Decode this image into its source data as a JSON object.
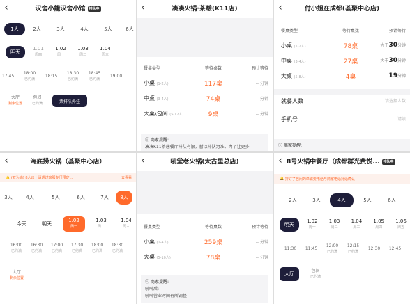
{
  "p1": {
    "title": "汉舍小籠汉舍小馆",
    "badge": "排队中",
    "party": [
      "1人",
      "2人",
      "3人",
      "4人",
      "5人",
      "6人"
    ],
    "days": [
      {
        "d": "明天",
        "s": ""
      },
      {
        "d": "1.01",
        "s": "周四"
      },
      {
        "d": "1.02",
        "s": "周一"
      },
      {
        "d": "1.03",
        "s": "周二"
      },
      {
        "d": "1.04",
        "s": "周三"
      }
    ],
    "times": [
      "17:45",
      "18:00",
      "18:15",
      "18:30",
      "18:45",
      "19:00"
    ],
    "time_sub": [
      "",
      "已约满",
      "",
      "已约满",
      "已约满",
      ""
    ],
    "areas": [
      {
        "n": "大厅",
        "s": "剩余位置"
      },
      {
        "n": "包间",
        "s": "已约满"
      }
    ],
    "btn": "票排队外挂"
  },
  "p2": {
    "title": "凑凑火锅·茶憩(K11店)",
    "head": [
      "餐桌类型",
      "等待桌数",
      "预计等待"
    ],
    "rows": [
      {
        "t": "小桌",
        "r": "(1-2人)",
        "n": "117桌",
        "w": "-- 分钟"
      },
      {
        "t": "中桌",
        "r": "(3-4人)",
        "n": "74桌",
        "w": "-- 分钟"
      },
      {
        "t": "大桌\\包间",
        "r": "(5-12人)",
        "n": "9桌",
        "w": "-- 分钟"
      }
    ],
    "notice_title": "商家提醒:",
    "notice_text": "凑凑K11茶憩餐厅排队有限，暂以排队为准，为了让更多"
  },
  "p3": {
    "title": "付小姐在成都(荟聚中心店)",
    "head": [
      "餐桌类型",
      "等待桌数",
      "预计等待"
    ],
    "rows": [
      {
        "t": "小桌",
        "r": "(1-2人)",
        "n": "78桌",
        "p": "大于",
        "w": "30",
        "u": "分钟"
      },
      {
        "t": "中桌",
        "r": "(3-4人)",
        "n": "27桌",
        "p": "大于",
        "w": "30",
        "u": "分钟"
      },
      {
        "t": "大桌",
        "r": "(5-8人)",
        "n": "4桌",
        "p": "",
        "w": "19",
        "u": "分钟"
      }
    ],
    "people_label": "就餐人数",
    "people_ph": "请选择人数",
    "phone_label": "手机号",
    "phone_ph": "请填",
    "notice_title": "商家提醒:"
  },
  "p4": {
    "title": "海底捞火锅（荟聚中心店）",
    "alert": "(双为满) 8人以上请通过客服专门预定...",
    "alert_r": "去看看",
    "party": [
      "3人",
      "4人",
      "5人",
      "6人",
      "7人",
      "8人"
    ],
    "days": [
      {
        "d": "今天",
        "s": ""
      },
      {
        "d": "明天",
        "s": ""
      },
      {
        "d": "1.02",
        "s": "周一"
      },
      {
        "d": "1.03",
        "s": "周二"
      },
      {
        "d": "1.04",
        "s": "周三"
      }
    ],
    "times": [
      "16:00",
      "16:30",
      "17:00",
      "17:30",
      "18:00",
      "18:30"
    ],
    "time_sub": [
      "已约满",
      "已约满",
      "已约满",
      "已约满",
      "已约满",
      "已约满"
    ],
    "area": {
      "n": "大厅",
      "s": "剩余位置"
    }
  },
  "p5": {
    "title": "吼堂老火锅(太古里总店)",
    "head": [
      "餐桌类型",
      "等待桌数",
      "预计等待"
    ],
    "rows": [
      {
        "t": "小桌",
        "r": "(1-4人)",
        "n": "259桌",
        "w": "-- 分钟"
      },
      {
        "t": "大桌",
        "r": "(5-10人)",
        "n": "78桌",
        "w": "-- 分钟"
      }
    ],
    "notice_title": "商家提醒:",
    "notice_text": "吼吼后:",
    "notice_text2": "吼吼营业时间有所调整"
  },
  "p6": {
    "title": "8号火锅中餐厅（成都群光费悦...",
    "badge": "排队中",
    "alert": "排订了包间的单需要电话与商家电话对话确认",
    "party": [
      "2人",
      "3人",
      "4人",
      "5人",
      "6人"
    ],
    "days": [
      {
        "d": "明天",
        "s": ""
      },
      {
        "d": "1.02",
        "s": "周一"
      },
      {
        "d": "1.03",
        "s": "周二"
      },
      {
        "d": "1.04",
        "s": "周三"
      },
      {
        "d": "1.05",
        "s": "周四"
      },
      {
        "d": "1.06",
        "s": "周五"
      }
    ],
    "times": [
      "11:30",
      "11:45",
      "12:00",
      "12:15",
      "12:30",
      "12:45"
    ],
    "time_sub": [
      "",
      "",
      "已约满",
      "已约满",
      "",
      ""
    ],
    "areas": [
      {
        "n": "大厅",
        "s": ""
      },
      {
        "n": "包间",
        "s": "已约满"
      }
    ]
  }
}
